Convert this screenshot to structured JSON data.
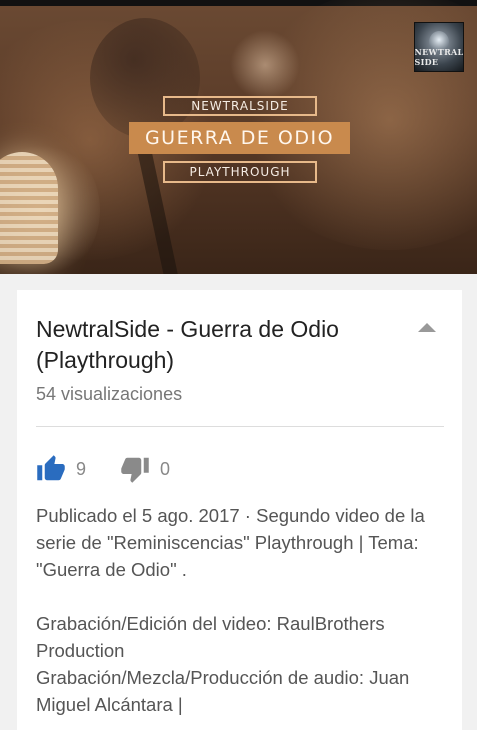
{
  "video": {
    "overlay_top": "NEWTRALSIDE",
    "overlay_main": "GUERRA DE ODIO",
    "overlay_bottom": "PLAYTHROUGH",
    "channel_badge_text": "NEWTRAL SIDE"
  },
  "info": {
    "title": "NewtralSide - Guerra de Odio (Playthrough)",
    "views": "54 visualizaciones",
    "likes": "9",
    "dislikes": "0",
    "description": [
      "Publicado el 5 ago. 2017 · Segundo video de la serie de \"Reminiscencias\" Playthrough | Tema: \"Guerra de Odio\" .",
      "",
      "Grabación/Edición del video: RaulBrothers Production",
      "Grabación/Mezcla/Producción de audio: Juan Miguel Alcántara |"
    ]
  },
  "colors": {
    "accent_blue": "#2a6cbf",
    "overlay_orange": "#c98a4d",
    "muted_gray": "#888888"
  },
  "icons": {
    "like": "thumbs-up-icon",
    "dislike": "thumbs-down-icon",
    "collapse": "caret-up-icon"
  }
}
